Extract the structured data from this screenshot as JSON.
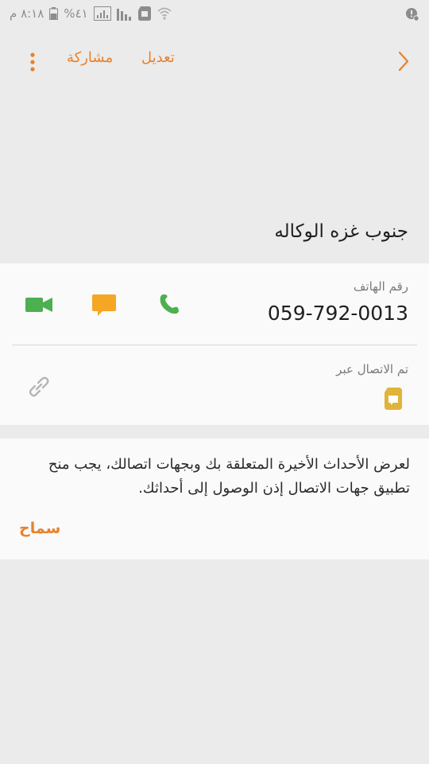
{
  "status_bar": {
    "time": "٨:١٨ م",
    "battery": "%٤١"
  },
  "toolbar": {
    "edit_label": "تعديل",
    "share_label": "مشاركة"
  },
  "contact": {
    "name": "جنوب غزه الوكاله",
    "phone_label": "رقم الهاتف",
    "phone_number": "059-792-0013",
    "linked_label": "تم الاتصال عبر"
  },
  "permission": {
    "message": "لعرض الأحداث الأخيرة المتعلقة بك وبجهات اتصالك، يجب منح تطبيق جهات الاتصال إذن الوصول إلى أحداثك.",
    "allow_label": "سماح"
  },
  "colors": {
    "accent": "#e8812a",
    "call_green": "#4caf50",
    "message_orange": "#f5a623",
    "sim_yellow": "#e0b33a"
  }
}
